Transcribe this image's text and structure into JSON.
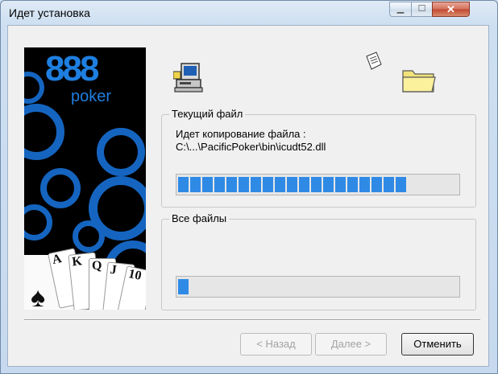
{
  "window": {
    "title": "Идет установка"
  },
  "titlebar": {
    "minimize_glyph": "▁",
    "maximize_glyph": "☐",
    "close_glyph": "✕"
  },
  "banner": {
    "brand_number": "888",
    "brand_word": "poker",
    "cards": [
      "A",
      "K",
      "Q",
      "J",
      "10"
    ],
    "suit_glyph": "♠"
  },
  "current_file": {
    "legend": "Текущий файл",
    "status_line": "Идет копирование  файла :",
    "path": "C:\\...\\PacificPoker\\bin\\icudt52.dll",
    "progress_percent": 80,
    "filled_chunks": 19
  },
  "all_files": {
    "legend": "Все файлы",
    "progress_percent": 5,
    "filled_chunks": 1
  },
  "buttons": {
    "back": "< Назад",
    "next": "Далее >",
    "cancel": "Отменить"
  },
  "colors": {
    "progress": "#2f8ae6",
    "brand_blue": "#1e7fe0"
  },
  "icons": [
    "setup-computer-icon",
    "document-icon",
    "folder-icon"
  ]
}
